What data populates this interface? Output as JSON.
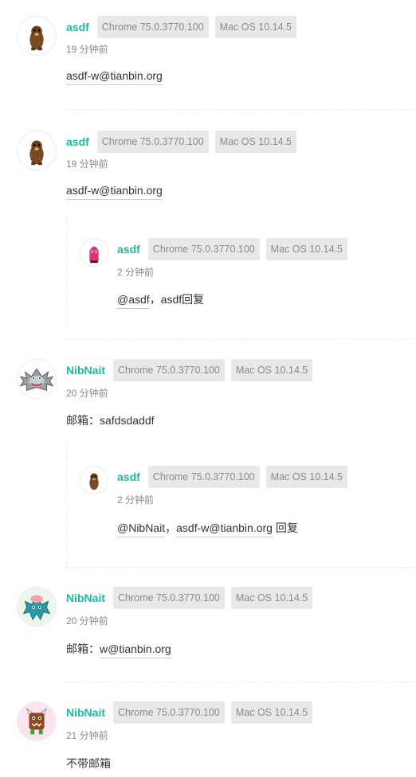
{
  "comments": [
    {
      "author": "asdf",
      "browser": "Chrome 75.0.3770.100",
      "os": "Mac OS 10.14.5",
      "time": "19 分钟前",
      "avatar_icon": "brown-bear-avatar-icon",
      "content": {
        "link": "asdf-w@tianbin.org"
      }
    },
    {
      "author": "asdf",
      "browser": "Chrome 75.0.3770.100",
      "os": "Mac OS 10.14.5",
      "time": "19 分钟前",
      "avatar_icon": "brown-bear-avatar-icon",
      "content": {
        "link": "asdf-w@tianbin.org"
      },
      "reply": {
        "author": "asdf",
        "browser": "Chrome 75.0.3770.100",
        "os": "Mac OS 10.14.5",
        "time": "2 分钟前",
        "avatar_icon": "pink-monster-avatar-icon",
        "content": {
          "mention": "@asdf",
          "text": "，asdf回复"
        }
      }
    },
    {
      "author": "NibNait",
      "browser": "Chrome 75.0.3770.100",
      "os": "Mac OS 10.14.5",
      "time": "20 分钟前",
      "avatar_icon": "gray-spiky-monster-avatar-icon",
      "content": {
        "text": "邮箱：safdsdaddf"
      },
      "reply": {
        "author": "asdf",
        "browser": "Chrome 75.0.3770.100",
        "os": "Mac OS 10.14.5",
        "time": "2 分钟前",
        "avatar_icon": "brown-bear-avatar-icon",
        "content": {
          "mention": "@NibNait",
          "sep": "，",
          "link": "asdf-w@tianbin.org",
          "suffix": " 回复"
        }
      }
    },
    {
      "author": "NibNait",
      "browser": "Chrome 75.0.3770.100",
      "os": "Mac OS 10.14.5",
      "time": "20 分钟前",
      "avatar_icon": "teal-brain-monster-avatar-icon",
      "content": {
        "prefix": "邮箱：",
        "link": "w@tianbin.org"
      }
    },
    {
      "author": "NibNait",
      "browser": "Chrome 75.0.3770.100",
      "os": "Mac OS 10.14.5",
      "time": "21 分钟前",
      "avatar_icon": "horned-brown-monster-avatar-icon",
      "content": {
        "text": "不带邮箱"
      }
    }
  ],
  "colors": {
    "nickname": "#1abc9c",
    "badge_bg": "#e8e8e8",
    "badge_text": "#8a8a8a"
  }
}
